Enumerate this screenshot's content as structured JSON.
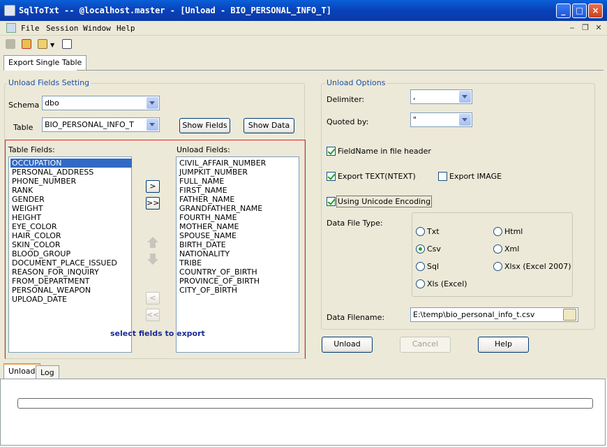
{
  "window": {
    "title": "SqlToTxt -- @localhost.master - [Unload - BIO_PERSONAL_INFO_T]"
  },
  "menu": {
    "items": [
      "File",
      "Session",
      "Window",
      "Help"
    ]
  },
  "tabs": {
    "top": [
      "Export Single Table"
    ],
    "bottom": [
      "Unload",
      "Log"
    ]
  },
  "unload_fields": {
    "legend": "Unload Fields Setting",
    "schema_label": "Schema",
    "schema_value": "dbo",
    "table_label": "Table",
    "table_value": "BIO_PERSONAL_INFO_T",
    "show_fields": "Show Fields",
    "show_data": "Show Data",
    "table_fields_label": "Table Fields:",
    "unload_fields_label": "Unload Fields:",
    "table_fields": [
      "OCCUPATION",
      "PERSONAL_ADDRESS",
      "PHONE_NUMBER",
      "RANK",
      "GENDER",
      "WEIGHT",
      "HEIGHT",
      "EYE_COLOR",
      "HAIR_COLOR",
      "SKIN_COLOR",
      "BLOOD_GROUP",
      "DOCUMENT_PLACE_ISSUED",
      "REASON_FOR_INQUIRY",
      "FROM_DEPARTMENT",
      "PERSONAL_WEAPON",
      "UPLOAD_DATE"
    ],
    "selected_field": "OCCUPATION",
    "unload_list": [
      "CIVIL_AFFAIR_NUMBER",
      "JUMPKIT_NUMBER",
      "FULL_NAME",
      "FIRST_NAME",
      "FATHER_NAME",
      "GRANDFATHER_NAME",
      "FOURTH_NAME",
      "MOTHER_NAME",
      "SPOUSE_NAME",
      "BIRTH_DATE",
      "NATIONALITY",
      "TRIBE",
      "COUNTRY_OF_BIRTH",
      "PROVINCE_OF_BIRTH",
      "CITY_OF_BIRTH"
    ],
    "add_one": ">",
    "add_all": ">>",
    "remove_one": "<",
    "remove_all": "<<",
    "hint": "select fields to export"
  },
  "unload_options": {
    "legend": "Unload Options",
    "delimiter_label": "Delimiter:",
    "delimiter_value": ",",
    "quoted_label": "Quoted by:",
    "quoted_value": "\"",
    "fieldname_header": "FieldName in file header",
    "export_text": "Export TEXT(NTEXT)",
    "export_image": "Export IMAGE",
    "unicode": "Using Unicode Encoding",
    "data_file_type_label": "Data File Type:",
    "file_types": [
      "Txt",
      "Html",
      "Csv",
      "Xml",
      "Sql",
      "Xlsx (Excel 2007)",
      "Xls (Excel)"
    ],
    "selected_type": "Csv",
    "data_filename_label": "Data Filename:",
    "data_filename": "E:\\temp\\bio_personal_info_t.csv"
  },
  "actions": {
    "unload": "Unload",
    "cancel": "Cancel",
    "help": "Help"
  },
  "window_controls": {
    "minimize": "_",
    "maximize": "□",
    "close": "×"
  }
}
